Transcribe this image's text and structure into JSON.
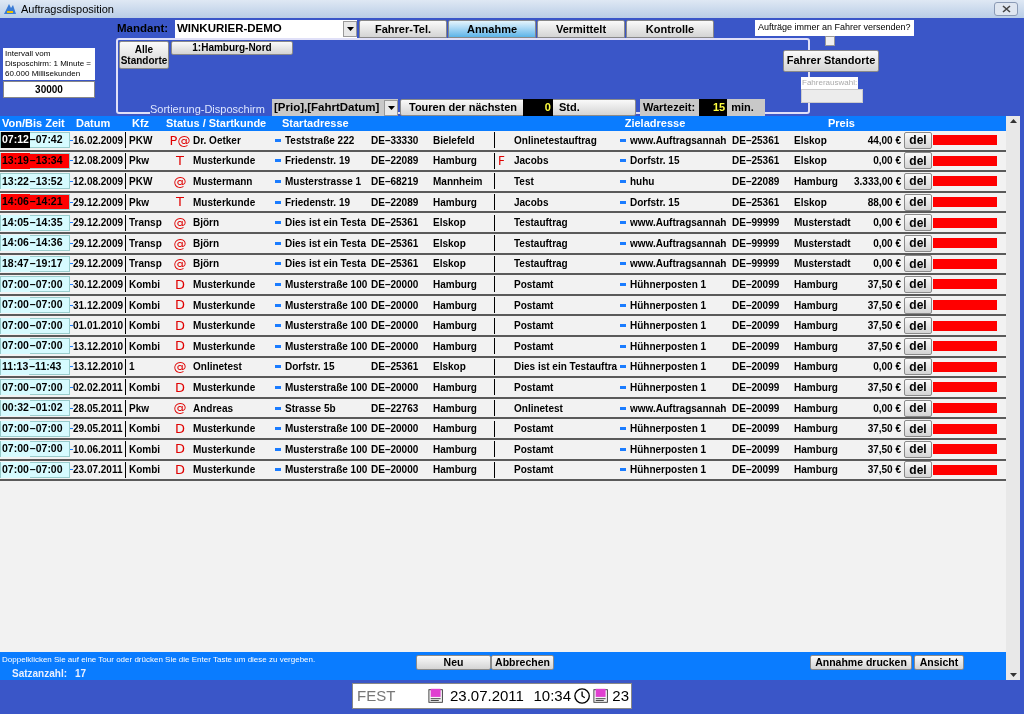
{
  "window": {
    "title": "Auftragsdisposition"
  },
  "interval": {
    "text": "Intervall vom Disposchirm: 1 Minute = 60.000 Millisekunden",
    "value": "30000"
  },
  "mandant": {
    "label": "Mandant:",
    "value": "WINKURIER-DEMO"
  },
  "tabs": [
    {
      "label": "Fahrer-Tel.",
      "selected": false
    },
    {
      "label": "Annahme",
      "selected": true
    },
    {
      "label": "Vermittelt",
      "selected": false
    },
    {
      "label": "Kontrolle",
      "selected": false
    }
  ],
  "standorte": {
    "all_button": "Alle Standorte",
    "items": [
      "1:Hamburg-Nord"
    ]
  },
  "sort": {
    "label": "Sortierung-Disposchirm",
    "value": "[Prio],[FahrtDatum]"
  },
  "touren": {
    "label": "Touren der nächsten",
    "value": "0",
    "unit": "Std."
  },
  "wartezeit": {
    "label": "Wartezeit:",
    "value": "15",
    "unit": "min."
  },
  "send_option": {
    "label": "Aufträge immer an Fahrer versenden?",
    "checked": false
  },
  "driver_locations_button": "Fahrer Standorte",
  "driver_select": {
    "label": "Fahrerauswahl:",
    "disabled": true
  },
  "table": {
    "columns": [
      "Von/Bis Zeit",
      "Datum",
      "Kfz",
      "Status / Startkunde",
      "Startadresse",
      "Zieladresse",
      "Preis"
    ],
    "rows": [
      {
        "time_from": "07:12",
        "time_to": "–07:42",
        "current": true,
        "overdue": false,
        "date": "16.02.2009",
        "vehicle": "PKW",
        "status": "P@",
        "customer": "Dr. Oetker",
        "street": "Teststraße 222",
        "zip": "DE–33330",
        "city": "Bielefeld",
        "dest_name": "Onlinetestauftrag",
        "dest_street": "www.Auftragsannah",
        "dest_zip": "DE–25361",
        "dest_city": "Elskop",
        "price": "44,00 €",
        "delete": "del"
      },
      {
        "time_from": "13:19",
        "time_to": "–13:34",
        "current": false,
        "overdue": true,
        "date": "12.08.2009",
        "vehicle": "Pkw",
        "status": "T",
        "customer": "Musterkunde",
        "street": "Friedenstr. 19",
        "zip": "DE–22089",
        "city": "Hamburg",
        "flag": "F",
        "dest_name": "Jacobs",
        "dest_street": "Dorfstr. 15",
        "dest_zip": "DE–25361",
        "dest_city": "Elskop",
        "price": "0,00 €",
        "delete": "del"
      },
      {
        "time_from": "13:22",
        "time_to": "–13:52",
        "current": false,
        "overdue": false,
        "date": "12.08.2009",
        "vehicle": "PKW",
        "status": "@",
        "customer": "Mustermann",
        "street": "Musterstrasse 1",
        "zip": "DE–68219",
        "city": "Mannheim",
        "dest_name": "Test",
        "dest_street": "huhu",
        "dest_zip": "DE–22089",
        "dest_city": "Hamburg",
        "price": "3.333,00 €",
        "delete": "del"
      },
      {
        "time_from": "14:06",
        "time_to": "–14:21",
        "current": false,
        "overdue": true,
        "date": "29.12.2009",
        "vehicle": "Pkw",
        "status": "T",
        "customer": "Musterkunde",
        "street": "Friedenstr. 19",
        "zip": "DE–22089",
        "city": "Hamburg",
        "dest_name": "Jacobs",
        "dest_street": "Dorfstr. 15",
        "dest_zip": "DE–25361",
        "dest_city": "Elskop",
        "price": "88,00 €",
        "delete": "del"
      },
      {
        "time_from": "14:05",
        "time_to": "–14:35",
        "current": false,
        "overdue": false,
        "date": "29.12.2009",
        "vehicle": "Transp",
        "status": "@",
        "customer": "Björn",
        "street": "Dies ist ein Testa",
        "zip": "DE–25361",
        "city": "Elskop",
        "dest_name": "Testauftrag",
        "dest_street": "www.Auftragsannah",
        "dest_zip": "DE–99999",
        "dest_city": "Musterstadt",
        "price": "0,00 €",
        "delete": "del"
      },
      {
        "time_from": "14:06",
        "time_to": "–14:36",
        "current": false,
        "overdue": false,
        "date": "29.12.2009",
        "vehicle": "Transp",
        "status": "@",
        "customer": "Björn",
        "street": "Dies ist ein Testa",
        "zip": "DE–25361",
        "city": "Elskop",
        "dest_name": "Testauftrag",
        "dest_street": "www.Auftragsannah",
        "dest_zip": "DE–99999",
        "dest_city": "Musterstadt",
        "price": "0,00 €",
        "delete": "del"
      },
      {
        "time_from": "18:47",
        "time_to": "–19:17",
        "current": false,
        "overdue": false,
        "date": "29.12.2009",
        "vehicle": "Transp",
        "status": "@",
        "customer": "Björn",
        "street": "Dies ist ein Testa",
        "zip": "DE–25361",
        "city": "Elskop",
        "dest_name": "Testauftrag",
        "dest_street": "www.Auftragsannah",
        "dest_zip": "DE–99999",
        "dest_city": "Musterstadt",
        "price": "0,00 €",
        "delete": "del"
      },
      {
        "time_from": "07:00",
        "time_to": "–07:00",
        "current": false,
        "overdue": false,
        "date": "30.12.2009",
        "vehicle": "Kombi",
        "status": "D",
        "customer": "Musterkunde",
        "street": "Musterstraße 100",
        "zip": "DE–20000",
        "city": "Hamburg",
        "dest_name": "Postamt",
        "dest_street": "Hühnerposten 1",
        "dest_zip": "DE–20099",
        "dest_city": "Hamburg",
        "price": "37,50 €",
        "delete": "del"
      },
      {
        "time_from": "07:00",
        "time_to": "–07:00",
        "current": false,
        "overdue": false,
        "date": "31.12.2009",
        "vehicle": "Kombi",
        "status": "D",
        "customer": "Musterkunde",
        "street": "Musterstraße 100",
        "zip": "DE–20000",
        "city": "Hamburg",
        "dest_name": "Postamt",
        "dest_street": "Hühnerposten 1",
        "dest_zip": "DE–20099",
        "dest_city": "Hamburg",
        "price": "37,50 €",
        "delete": "del"
      },
      {
        "time_from": "07:00",
        "time_to": "–07:00",
        "current": false,
        "overdue": false,
        "date": "01.01.2010",
        "vehicle": "Kombi",
        "status": "D",
        "customer": "Musterkunde",
        "street": "Musterstraße 100",
        "zip": "DE–20000",
        "city": "Hamburg",
        "dest_name": "Postamt",
        "dest_street": "Hühnerposten 1",
        "dest_zip": "DE–20099",
        "dest_city": "Hamburg",
        "price": "37,50 €",
        "delete": "del"
      },
      {
        "time_from": "07:00",
        "time_to": "–07:00",
        "current": false,
        "overdue": false,
        "date": "13.12.2010",
        "vehicle": "Kombi",
        "status": "D",
        "customer": "Musterkunde",
        "street": "Musterstraße 100",
        "zip": "DE–20000",
        "city": "Hamburg",
        "dest_name": "Postamt",
        "dest_street": "Hühnerposten 1",
        "dest_zip": "DE–20099",
        "dest_city": "Hamburg",
        "price": "37,50 €",
        "delete": "del"
      },
      {
        "time_from": "11:13",
        "time_to": "–11:43",
        "current": false,
        "overdue": false,
        "date": "13.12.2010",
        "vehicle": "1",
        "status": "@",
        "customer": "Onlinetest",
        "street": "Dorfstr. 15",
        "zip": "DE–25361",
        "city": "Elskop",
        "dest_name": "Dies ist ein Testauftra",
        "dest_street": "Hühnerposten 1",
        "dest_zip": "DE–20099",
        "dest_city": "Hamburg",
        "price": "0,00 €",
        "delete": "del"
      },
      {
        "time_from": "07:00",
        "time_to": "–07:00",
        "current": false,
        "overdue": false,
        "date": "02.02.2011",
        "vehicle": "Kombi",
        "status": "D",
        "customer": "Musterkunde",
        "street": "Musterstraße 100",
        "zip": "DE–20000",
        "city": "Hamburg",
        "dest_name": "Postamt",
        "dest_street": "Hühnerposten 1",
        "dest_zip": "DE–20099",
        "dest_city": "Hamburg",
        "price": "37,50 €",
        "delete": "del"
      },
      {
        "time_from": "00:32",
        "time_to": "–01:02",
        "current": false,
        "overdue": false,
        "date": "28.05.2011",
        "vehicle": "Pkw",
        "status": "@",
        "customer": "Andreas",
        "street": "Strasse 5b",
        "zip": "DE–22763",
        "city": "Hamburg",
        "dest_name": "Onlinetest",
        "dest_street": "www.Auftragsannah",
        "dest_zip": "DE–20099",
        "dest_city": "Hamburg",
        "price": "0,00 €",
        "delete": "del"
      },
      {
        "time_from": "07:00",
        "time_to": "–07:00",
        "current": false,
        "overdue": false,
        "date": "29.05.2011",
        "vehicle": "Kombi",
        "status": "D",
        "customer": "Musterkunde",
        "street": "Musterstraße 100",
        "zip": "DE–20000",
        "city": "Hamburg",
        "dest_name": "Postamt",
        "dest_street": "Hühnerposten 1",
        "dest_zip": "DE–20099",
        "dest_city": "Hamburg",
        "price": "37,50 €",
        "delete": "del"
      },
      {
        "time_from": "07:00",
        "time_to": "–07:00",
        "current": false,
        "overdue": false,
        "date": "10.06.2011",
        "vehicle": "Kombi",
        "status": "D",
        "customer": "Musterkunde",
        "street": "Musterstraße 100",
        "zip": "DE–20000",
        "city": "Hamburg",
        "dest_name": "Postamt",
        "dest_street": "Hühnerposten 1",
        "dest_zip": "DE–20099",
        "dest_city": "Hamburg",
        "price": "37,50 €",
        "delete": "del"
      },
      {
        "time_from": "07:00",
        "time_to": "–07:00",
        "current": false,
        "overdue": false,
        "date": "23.07.2011",
        "vehicle": "Kombi",
        "status": "D",
        "customer": "Musterkunde",
        "street": "Musterstraße 100",
        "zip": "DE–20000",
        "city": "Hamburg",
        "dest_name": "Postamt",
        "dest_street": "Hühnerposten 1",
        "dest_zip": "DE–20099",
        "dest_city": "Hamburg",
        "price": "37,50 €",
        "delete": "del"
      }
    ]
  },
  "footer": {
    "hint": "Doppelklicken Sie auf eine Tour oder drücken Sie die Enter Taste um diese zu vergeben.",
    "count_label": "Satzanzahl:",
    "count": "17",
    "buttons": [
      "Neu",
      "Abbrechen",
      "Annahme drucken",
      "Ansicht"
    ]
  },
  "status_bar": {
    "mode": "FEST",
    "date": "23.07.2011",
    "time": "10:34",
    "day": "23"
  }
}
